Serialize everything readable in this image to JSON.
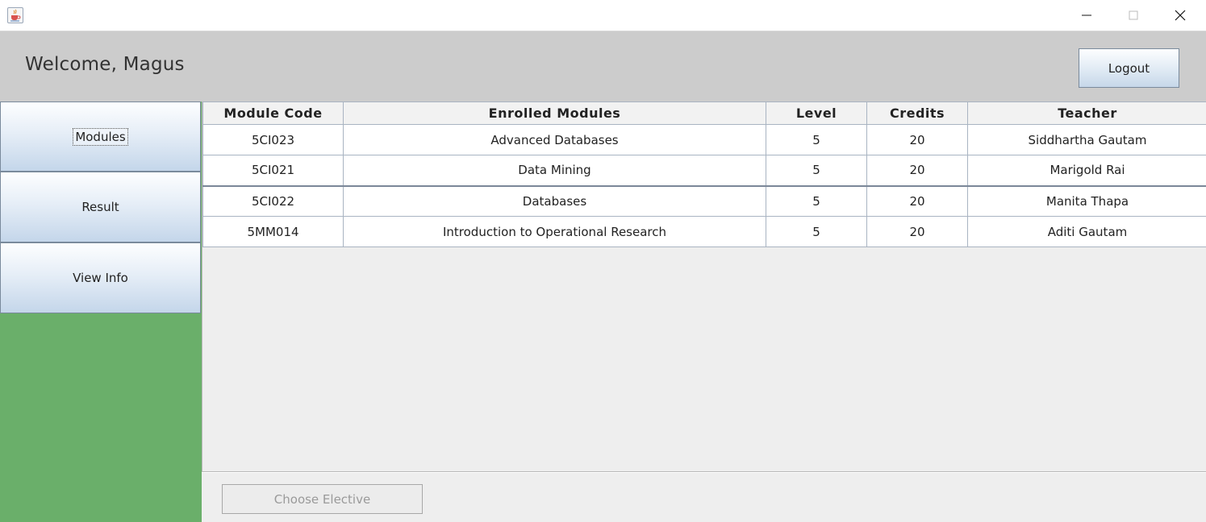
{
  "window": {
    "icon": "java-cup-icon",
    "controls": [
      "minimize-icon",
      "maximize-icon",
      "close-icon"
    ]
  },
  "header": {
    "welcome": "Welcome, Magus",
    "logout_label": "Logout"
  },
  "sidebar": {
    "items": [
      {
        "label": "Modules",
        "focused": true
      },
      {
        "label": "Result"
      },
      {
        "label": "View Info"
      }
    ]
  },
  "table": {
    "columns": [
      "Module Code",
      "Enrolled Modules",
      "Level",
      "Credits",
      "Teacher"
    ],
    "rows": [
      [
        "5CI023",
        "Advanced Databases",
        "5",
        "20",
        "Siddhartha Gautam"
      ],
      [
        "5CI021",
        "Data Mining",
        "5",
        "20",
        "Marigold Rai"
      ],
      [
        "5CI022",
        "Databases",
        "5",
        "20",
        "Manita Thapa"
      ],
      [
        "5MM014",
        "Introduction to Operational Research",
        "5",
        "20",
        "Aditi Gautam"
      ]
    ]
  },
  "footer": {
    "elective_label": "Choose Elective",
    "elective_enabled": false
  },
  "colors": {
    "header_bg": "#cccccc",
    "sidebar_bg": "#6aaf6a",
    "content_bg": "#eeeeee"
  }
}
